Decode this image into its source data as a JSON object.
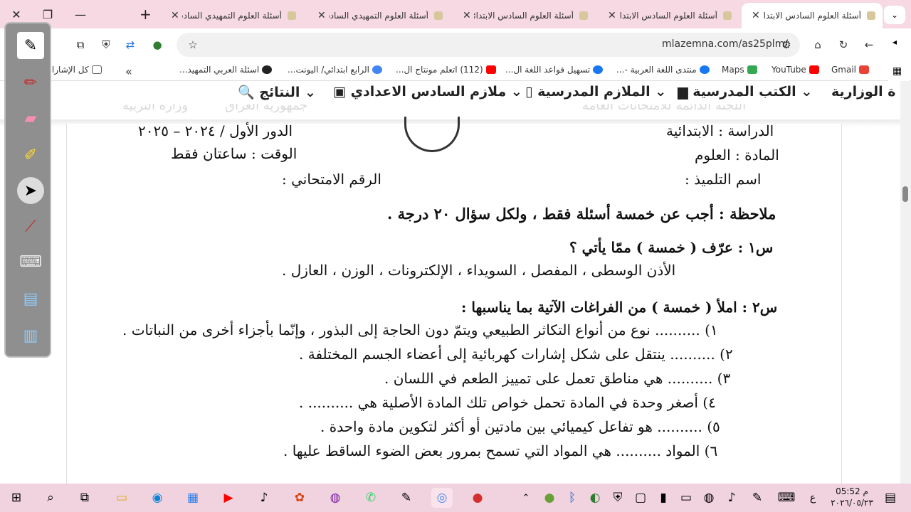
{
  "window": {
    "close": "✕",
    "restore": "❐",
    "minimize": "—",
    "new_tab": "+",
    "tab_menu": "⌄",
    "tabs": [
      {
        "title": "أسئلة العلوم السادس الابتدائي",
        "active": true
      },
      {
        "title": "أسئلة العلوم السادس الابتدائي"
      },
      {
        "title": "أسئلة العلوم السادس الابتدائي"
      },
      {
        "title": "أسئلة العلوم التمهيدي السادس"
      },
      {
        "title": "أسئلة العلوم التمهيدي السادس"
      }
    ]
  },
  "toolbar": {
    "url": "mlazemna.com/as25plm/"
  },
  "bookmarks": {
    "all_bookmarks": "كل الإشارات المرجعية",
    "items": [
      {
        "label": "Gmail",
        "color": "#ea4335"
      },
      {
        "label": "YouTube",
        "color": "#ff0000"
      },
      {
        "label": "Maps",
        "color": "#34a853"
      },
      {
        "label": "منتدى اللغة العربية -...",
        "color": "#1877f2"
      },
      {
        "label": "تسهيل قواعد اللغة ال...",
        "color": "#1877f2"
      },
      {
        "label": "(112) اتعلم مونتاج ال...",
        "color": "#ff0000"
      },
      {
        "label": "الرابع ابتدائي/ اليونت...",
        "color": "#4285f4"
      },
      {
        "label": "اسئلة العربي التمهيد...",
        "color": "#222222"
      }
    ]
  },
  "site_nav": {
    "items": [
      "ة الوزارية",
      "الكتب المدرسية",
      "الملازم المدرسية",
      "ملازم السادس الاعدادي",
      "النتائج"
    ]
  },
  "exam": {
    "faded_header": {
      "ministry": "وزارة التربية",
      "republic": "جمهورية العراق",
      "committee": "اللجنة الدائمة للامتحانات العامة"
    },
    "stage": "الدراسة : الابتدائية",
    "subject": "المادة : العلوم",
    "student_name": "اسم التلميذ :",
    "round": "الدور الأول / ٢٠٢٤ – ٢٠٢٥",
    "time": "الوقت : ساعتان فقط",
    "exam_number": "الرقم الامتحاني :",
    "note": "ملاحظة : أجب عن خمسة أسئلة فقط ، ولكل سؤال ٢٠ درجة .",
    "q1_title": "س١ : عرّف ( خمسة ) ممّا يأتي ؟",
    "q1_terms": "الأذن الوسطى ، المفصل ، السويداء ، الإلكترونات ، الوزن ، العازل .",
    "q2_title": "س٢ : املأ ( خمسة ) من الفراغات الآتية بما يناسبها :",
    "q2_items": [
      "١) .......... نوع من أنواع التكاثر الطبيعي ويتمّ دون الحاجة إلى البذور ، وإنّما بأجزاء أخرى من النباتات .",
      "٢) .......... ينتقل على شكل إشارات كهربائية إلى أعضاء الجسم المختلفة .",
      "٣) .......... هي مناطق تعمل على تمييز الطعم في اللسان .",
      "٤) أصغر وحدة في المادة تحمل خواص تلك المادة الأصلية هي .......... .",
      "٥) .......... هو تفاعل كيميائي بين مادتين أو أكثر لتكوين مادة واحدة .",
      "٦) المواد .......... هي المواد التي تسمح بمرور بعض الضوء الساقط عليها ."
    ]
  },
  "pen_toolbar": {
    "tools": [
      "pen-icon",
      "eraser-icon",
      "highlighter-icon",
      "pointer-icon",
      "laser-icon",
      "keyboard-icon",
      "screen-icon",
      "capture-icon"
    ]
  },
  "taskbar": {
    "time": "05:52 م",
    "date": "٢٠٢٦/٠٥/٢٣",
    "language": "ع"
  }
}
